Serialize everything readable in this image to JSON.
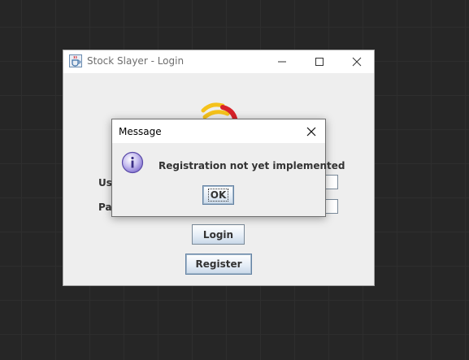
{
  "window": {
    "title": "Stock Slayer - Login",
    "icons": {
      "app": "java-cup-icon",
      "minimize": "minimize-icon",
      "maximize": "maximize-icon",
      "close": "close-icon"
    }
  },
  "form": {
    "username_label": "Us",
    "password_label": "Pa",
    "username_value": "",
    "password_value": "",
    "login_label": "Login",
    "register_label": "Register"
  },
  "dialog": {
    "title": "Message",
    "message": "Registration not yet implemented",
    "ok_label": "OK",
    "icons": {
      "info": "information-icon",
      "close": "close-icon"
    }
  },
  "colors": {
    "desktop_bg": "#262626",
    "window_bg": "#eeeeee",
    "button_gradient_bottom": "#c9d8e8",
    "info_icon": "#8b7bd4",
    "logo_yellow": "#f5c21b",
    "logo_red": "#d8232a"
  }
}
